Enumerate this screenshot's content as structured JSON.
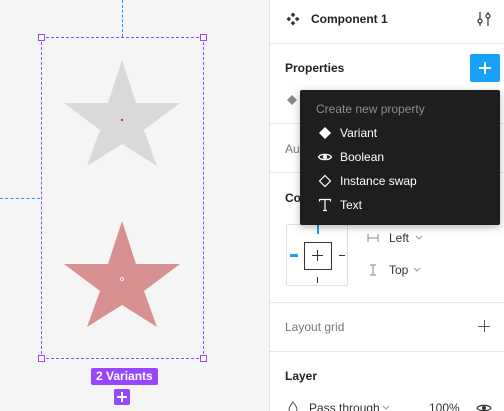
{
  "canvas": {
    "variants_badge": "2 Variants"
  },
  "panel": {
    "component_title": "Component 1",
    "properties_heading": "Properties",
    "auto_layout_partial": "Aut",
    "constraints_partial": "Co",
    "constraint_horizontal": "Left",
    "constraint_vertical": "Top",
    "layout_grid_heading": "Layout grid",
    "layer_heading": "Layer",
    "blend_mode": "Pass through",
    "opacity": "100%"
  },
  "dropdown": {
    "header": "Create new property",
    "items": [
      {
        "label": "Variant",
        "icon": "variant-diamond-icon"
      },
      {
        "label": "Boolean",
        "icon": "eye-icon"
      },
      {
        "label": "Instance swap",
        "icon": "diamond-outline-icon"
      },
      {
        "label": "Text",
        "icon": "text-icon"
      }
    ]
  },
  "colors": {
    "selection": "#9747ff",
    "accent": "#18a0fb",
    "star_default": "#d9d9d9",
    "star_variant": "#d99090"
  }
}
